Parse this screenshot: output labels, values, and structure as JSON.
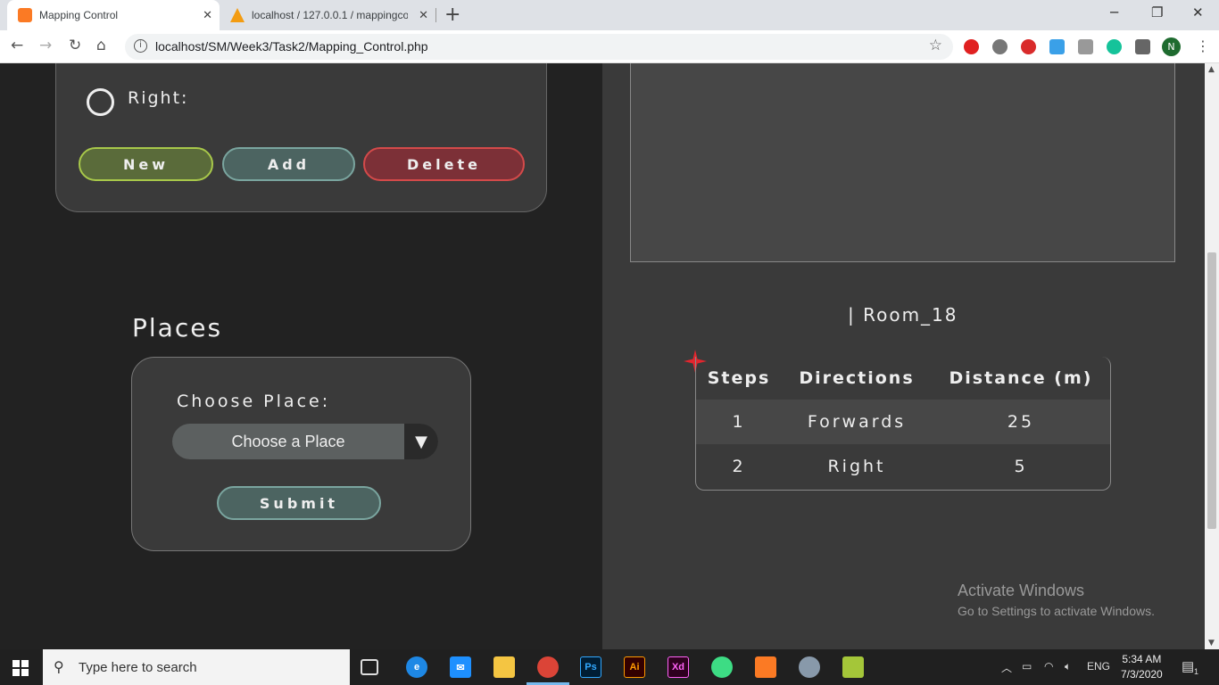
{
  "browser": {
    "tabs": [
      {
        "label": "Mapping Control",
        "active": true
      },
      {
        "label": "localhost / 127.0.0.1 / mappingco",
        "active": false
      }
    ],
    "url": "localhost/SM/Week3/Task2/Mapping_Control.php",
    "profile_initial": "N"
  },
  "directions_panel": {
    "radio_label": "Right:",
    "buttons": {
      "new": "New",
      "add": "Add",
      "delete": "Delete"
    }
  },
  "places": {
    "title": "Places",
    "choose_label": "Choose Place:",
    "select_value": "Choose a Place",
    "submit_label": "Submit"
  },
  "route": {
    "room_label": "| Room_18",
    "headers": {
      "steps": "Steps",
      "directions": "Directions",
      "distance": "Distance (m)"
    },
    "rows": [
      {
        "step": "1",
        "direction": "Forwards",
        "distance": "25"
      },
      {
        "step": "2",
        "direction": "Right",
        "distance": "5"
      }
    ]
  },
  "watermark": {
    "line1": "Activate Windows",
    "line2": "Go to Settings to activate Windows."
  },
  "taskbar": {
    "search_placeholder": "Type here to search",
    "lang": "ENG",
    "time": "5:34 AM",
    "date": "7/3/2020",
    "notification_count": "1"
  },
  "colors": {
    "new_button": "#5a6b3a",
    "add_button": "#4c6461",
    "delete_button": "#7c3037",
    "page_bg": "#222222",
    "panel_bg": "#3a3a3a"
  }
}
